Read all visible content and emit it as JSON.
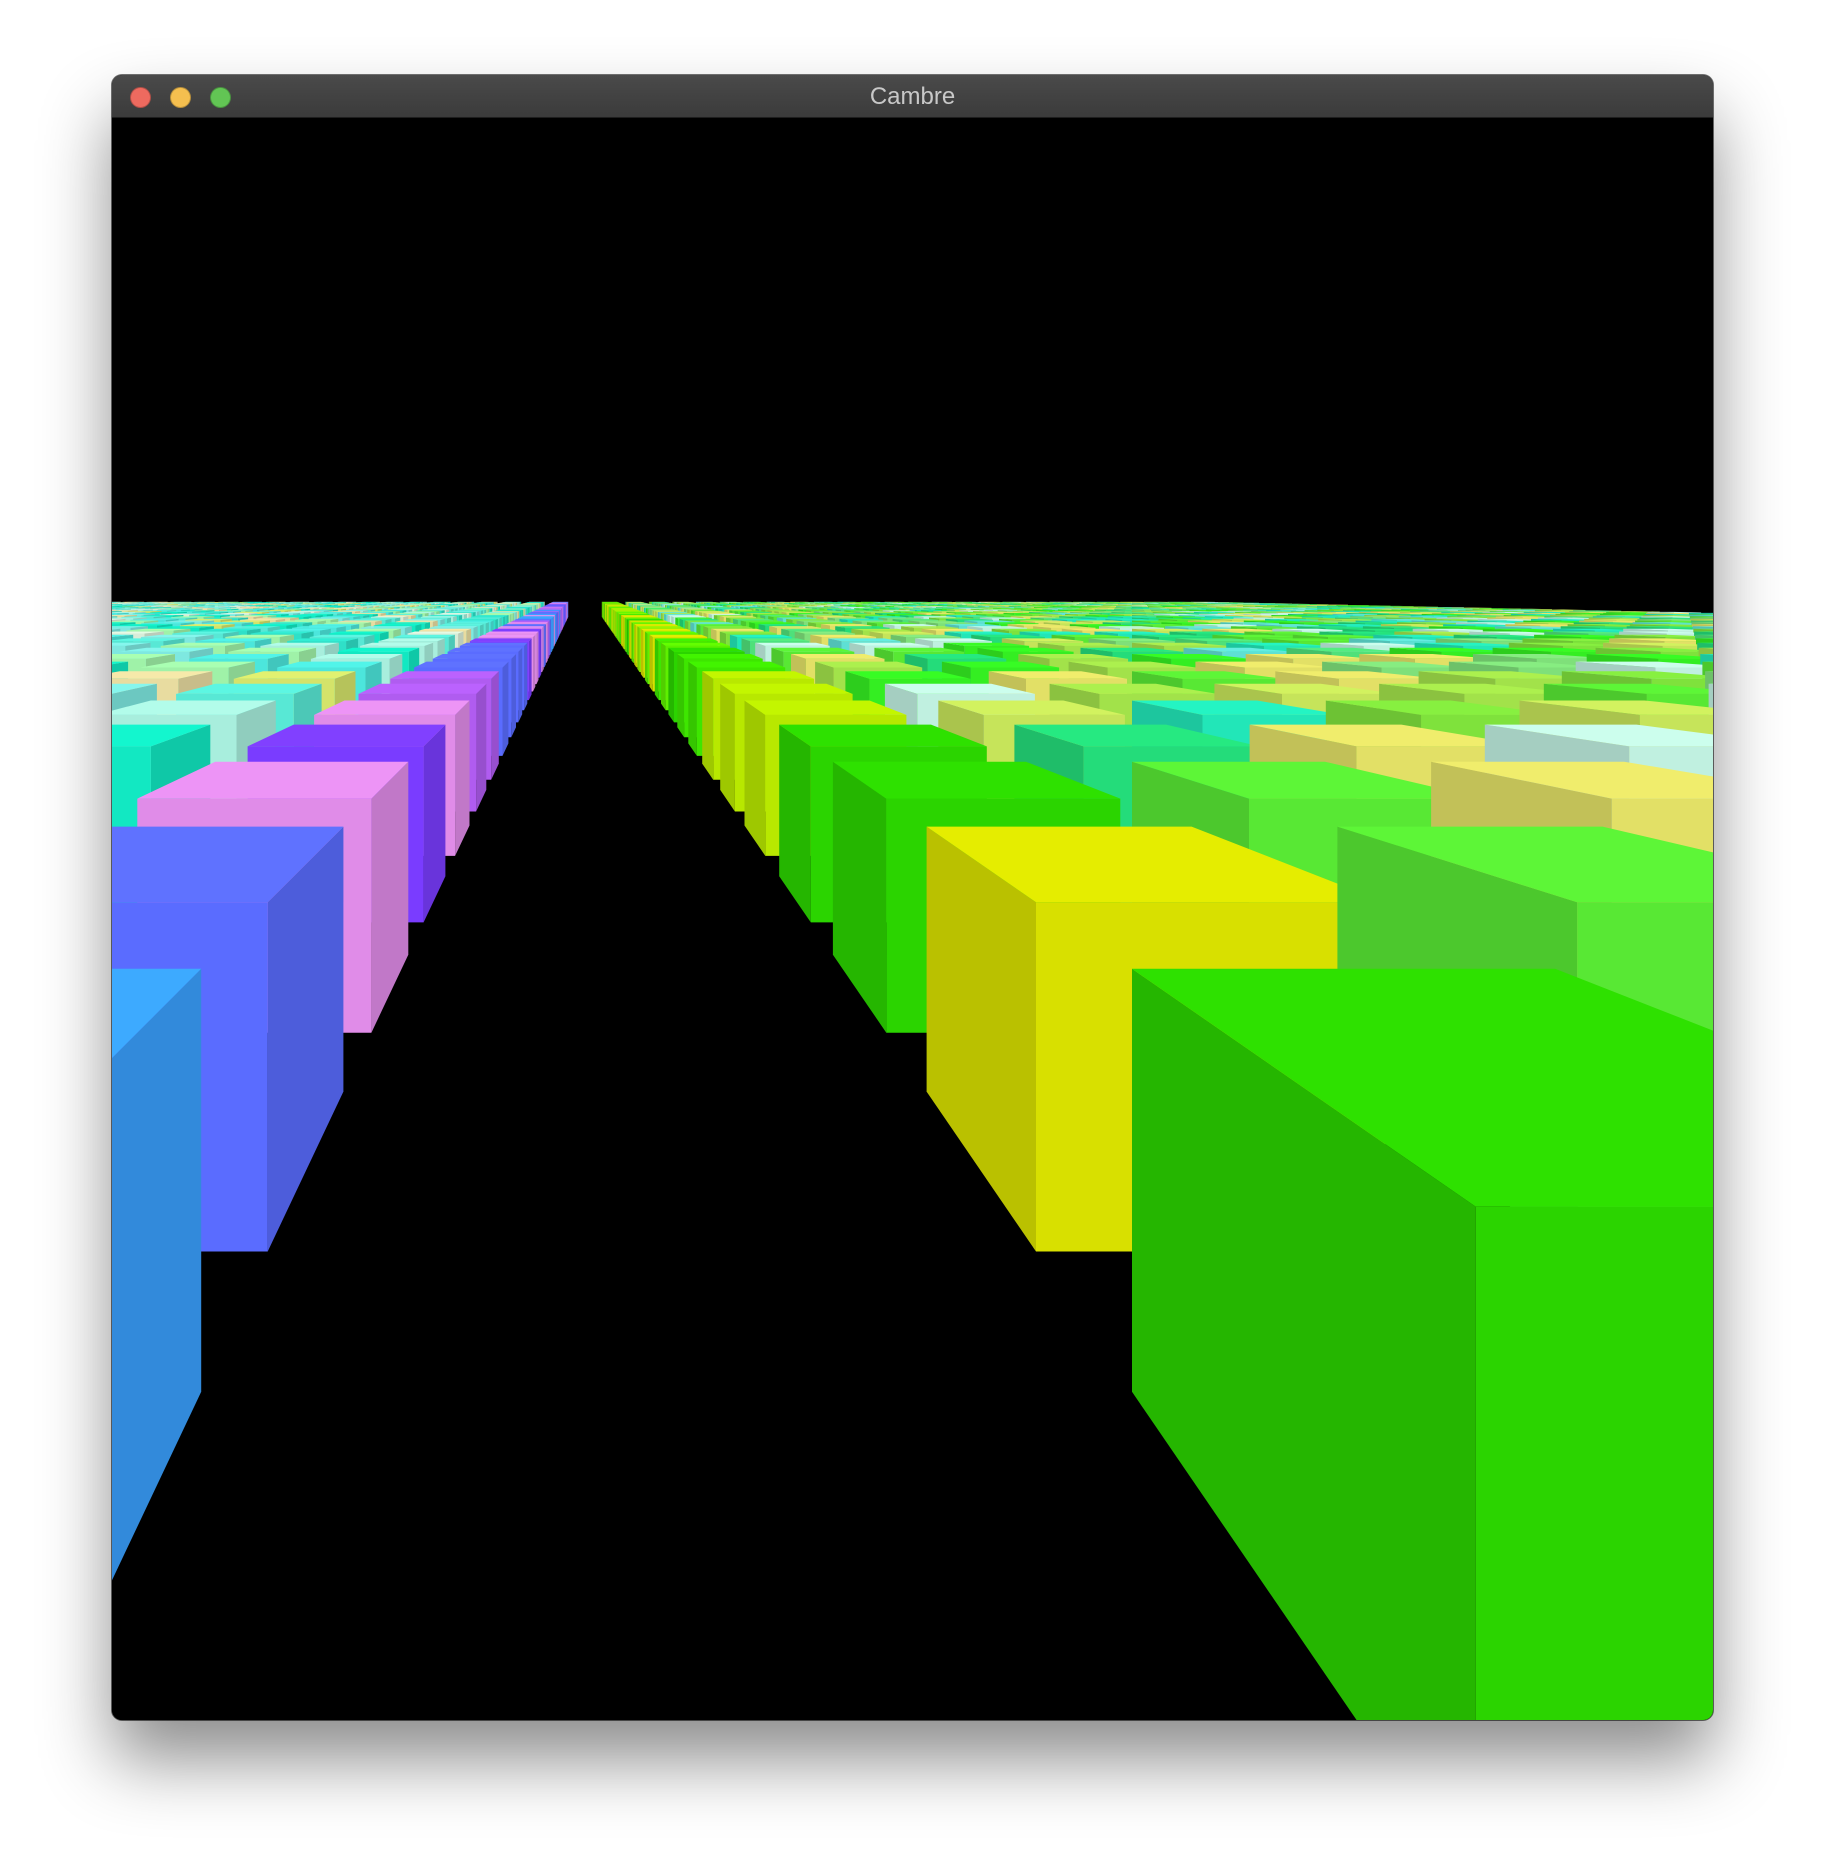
{
  "window": {
    "title": "Cambre",
    "controls": {
      "close_color": "#ee6a5f",
      "minimize_color": "#f5bf4f",
      "zoom_color": "#62c554"
    }
  },
  "scene": {
    "background_color": "#000000",
    "description_colors": {
      "left_field": [
        "#4ce6dc",
        "#58e8d5",
        "#7ee8e0",
        "#a8eedd",
        "#d8ecd8",
        "#2fe0c8",
        "#12e8c2",
        "#9ff2a8",
        "#d4e36a",
        "#e8dca0"
      ],
      "left_edge_strip": [
        "#3aa0ff",
        "#5a6cff",
        "#7a3cff",
        "#b05cf0",
        "#e08ce8"
      ],
      "center_column": [
        "#3ee600",
        "#5ef000",
        "#8aee00",
        "#b8e800",
        "#d8e000",
        "#2bd400"
      ],
      "right_field": [
        "#34ee22",
        "#58e834",
        "#7fe23c",
        "#a2e24a",
        "#c6e45a",
        "#e2e066",
        "#7fe07a",
        "#4fe07a",
        "#24dc7a",
        "#22e6b8",
        "#5ee0d4",
        "#c0f0e0"
      ]
    }
  }
}
